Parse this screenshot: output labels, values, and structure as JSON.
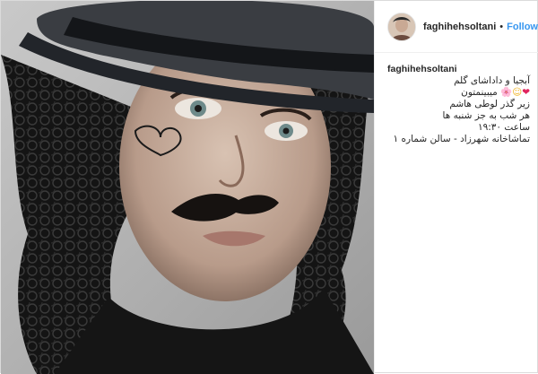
{
  "post": {
    "username": "faghihehsoltani",
    "follow_label": "Follow",
    "separator": "•",
    "caption_lines": [
      "آبجیا و داداشای گلم",
      "میبینمتون",
      "زیر گذر لوطی هاشم",
      "هر شب به جز شنبه ها",
      "ساعت ۱۹:۳۰",
      "تماشاخانه شهرزاد - سالن شماره ۱"
    ],
    "caption_emojis": [
      "❤",
      "☺",
      "🌸"
    ]
  },
  "colors": {
    "follow": "#3897f0",
    "text": "#262626",
    "border": "#dbdbdb"
  },
  "icons": {
    "avatar": "profile-avatar",
    "photo": "post-photo"
  }
}
